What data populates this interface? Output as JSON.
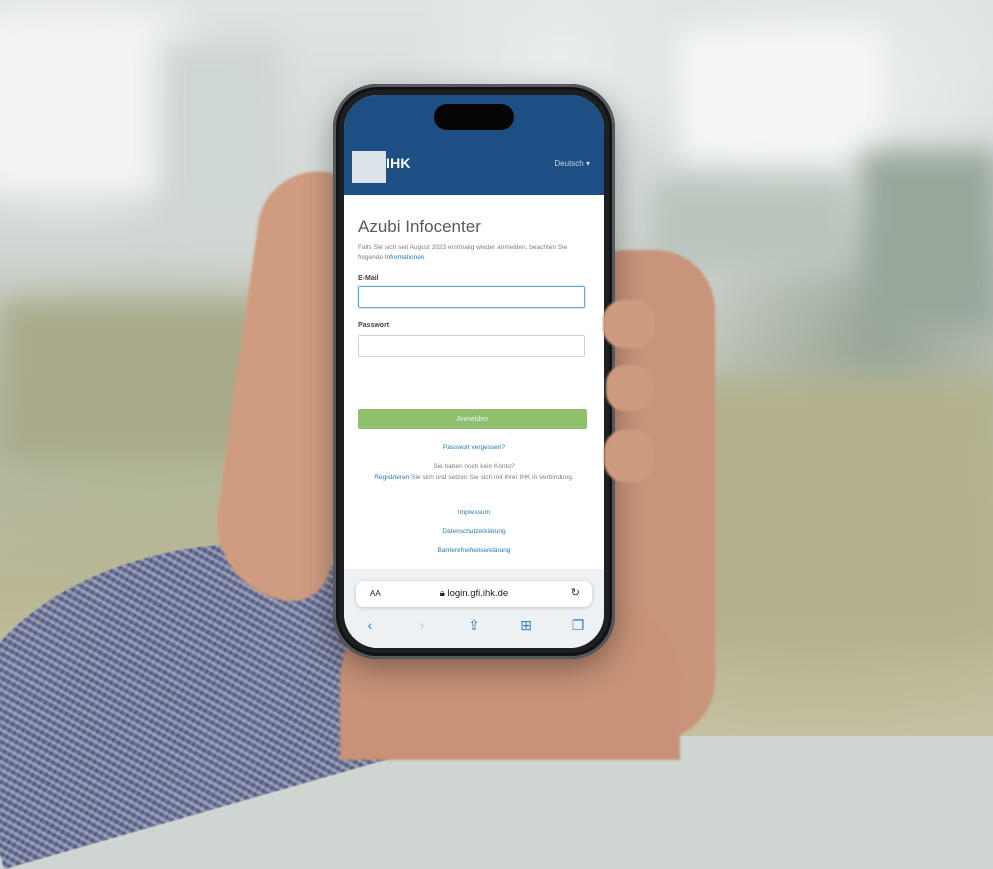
{
  "app": {
    "logo_text": "IHK",
    "language_selector": "Deutsch",
    "page_title": "Azubi Infocenter",
    "intro_text": "Falls Sie sich seit August 2023 erstmalig wieder anmelden, beachten Sie folgende",
    "intro_link": "Informationen",
    "email_label": "E-Mail",
    "email_value": "",
    "password_label": "Passwort",
    "password_value": "",
    "login_button": "Anmelden",
    "forgot_password_link": "Passwort vergessen?",
    "no_account_text": "Sie haben noch kein Konto?",
    "register_link": "Registrieren",
    "register_text": "Sie sich und setzen Sie sich mit Ihrer IHK in Verbindung.",
    "imprint_link": "Impressum",
    "privacy_link": "Datenschutzerklärung",
    "accessibility_link": "Barrierefreiheitserklärung"
  },
  "browser": {
    "text_size_label": "AA",
    "url": "login.gfi.ihk.de",
    "lock_icon": "lock-icon",
    "reload_icon": "reload-icon",
    "toolbar": [
      "back-icon",
      "forward-icon",
      "share-icon",
      "bookmarks-icon",
      "tabs-icon"
    ]
  },
  "colors": {
    "header_blue": "#1e4f84",
    "button_green": "#8fc06e",
    "link_blue": "#2a79b6"
  }
}
